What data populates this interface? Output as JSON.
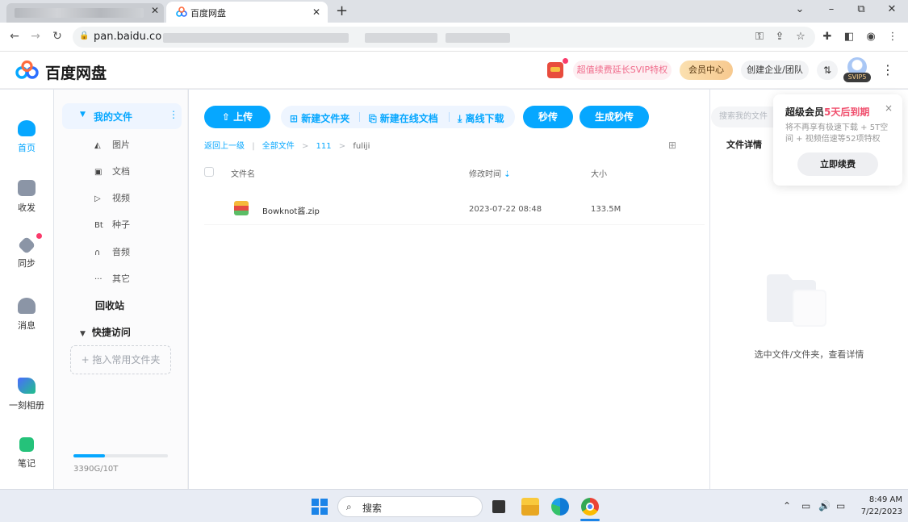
{
  "browser": {
    "active_tab_title": "百度网盘",
    "url": "pan.baidu.co",
    "new_tab_label": "+",
    "window": {
      "minimize": "–",
      "maximize": "⧉",
      "close": "✕",
      "dropdown": "⌄"
    }
  },
  "header": {
    "brand": "百度网盘",
    "promo": "超值续费延长SVIP特权",
    "vip_center": "会员中心",
    "corp": "创建企业/团队",
    "transfer": "⇅",
    "svip_badge": "SVIP5",
    "more": "⋮"
  },
  "rail": [
    {
      "label": "首页",
      "icon": "cloud-icon"
    },
    {
      "label": "收发",
      "icon": "share-icon"
    },
    {
      "label": "同步",
      "icon": "sync-icon"
    },
    {
      "label": "消息",
      "icon": "people-icon"
    },
    {
      "label": "一刻相册",
      "icon": "album-icon"
    },
    {
      "label": "笔记",
      "icon": "note-icon"
    }
  ],
  "sidebar": {
    "my_files": "我的文件",
    "categories": [
      {
        "icon": "◭",
        "label": "图片"
      },
      {
        "icon": "▣",
        "label": "文档"
      },
      {
        "icon": "▷",
        "label": "视频"
      },
      {
        "icon": "Bt",
        "label": "种子"
      },
      {
        "icon": "∩",
        "label": "音频"
      },
      {
        "icon": "···",
        "label": "其它"
      }
    ],
    "recycle": "回收站",
    "quick_access": "快捷访问",
    "drop_hint": "+ 拖入常用文件夹",
    "quota_text": "3390G/10T",
    "quota_fraction": 0.331
  },
  "toolbar": {
    "upload": "上传",
    "new_folder": "新建文件夹",
    "new_doc": "新建在线文档",
    "offline": "离线下载",
    "instant": "秒传",
    "gen_instant": "生成秒传"
  },
  "breadcrumb": {
    "back": "返回上一级",
    "all": "全部文件",
    "folder": "111",
    "current": "fuliji",
    "sep": ">",
    "bar": "|"
  },
  "table": {
    "col_name": "文件名",
    "col_modified": "修改时间",
    "col_size": "大小",
    "rows": [
      {
        "name": "Bowknot酱.zip",
        "modified": "2023-07-22 08:48",
        "size": "133.5M"
      }
    ]
  },
  "detail": {
    "search_placeholder": "搜索我的文件",
    "title": "文件详情",
    "empty": "选中文件/文件夹，查看详情"
  },
  "popup": {
    "title_prefix": "超级会员",
    "title_highlight": "5天后到期",
    "desc": "将不再享有极速下载 + 5T空间 + 视频倍速等52项特权",
    "button": "立即续费",
    "close": "×"
  },
  "taskbar": {
    "search": "搜索",
    "time": "8:49 AM",
    "date": "7/22/2023"
  }
}
